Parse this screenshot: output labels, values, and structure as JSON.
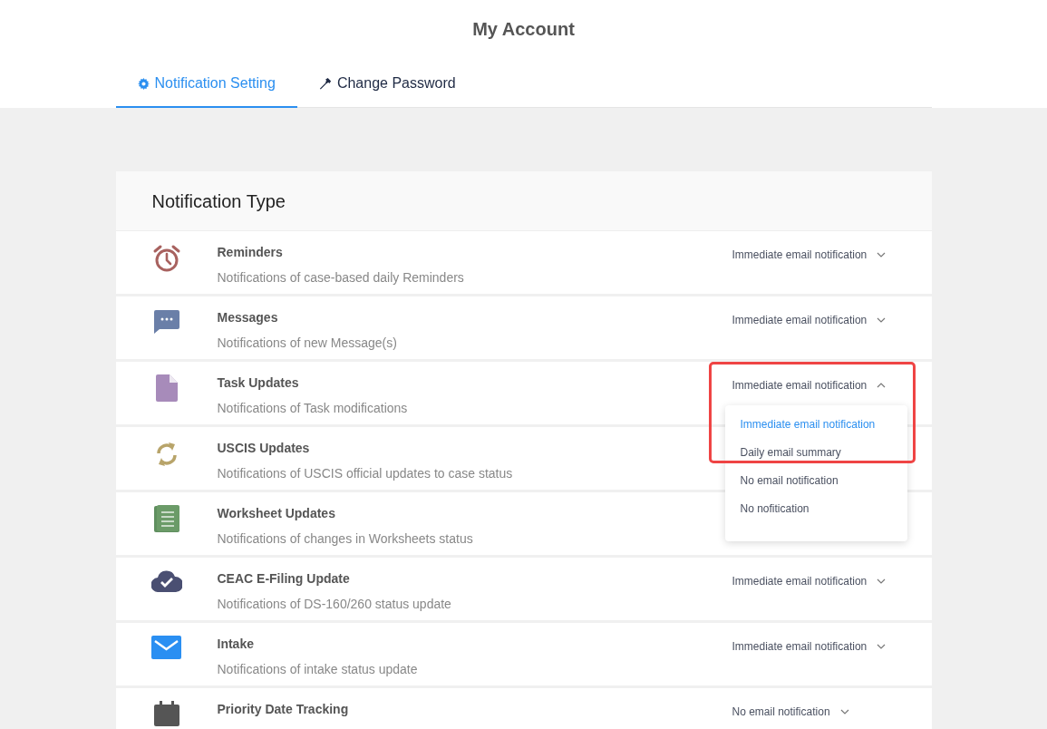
{
  "page": {
    "title": "My Account"
  },
  "tabs": [
    {
      "label": "Notification Setting",
      "selected": true
    },
    {
      "label": "Change Password",
      "selected": false
    }
  ],
  "card": {
    "title": "Notification Type"
  },
  "rows": [
    {
      "title": "Reminders",
      "description": "Notifications of case-based daily Reminders",
      "setting": {
        "value": "Immediate email notification",
        "expanded": false
      }
    },
    {
      "title": "Messages",
      "description": "Notifications of new Message(s)",
      "setting": {
        "value": "Immediate email notification",
        "expanded": false
      }
    },
    {
      "title": "Task Updates",
      "description": "Notifications of Task modifications",
      "setting": {
        "value": "Immediate email notification",
        "expanded": true,
        "highlighted": true,
        "options": [
          {
            "label": "Immediate email notification",
            "selected": true
          },
          {
            "label": "Daily email summary",
            "selected": false
          },
          {
            "label": "No email notification",
            "selected": false
          },
          {
            "label": "No nofitication",
            "selected": false
          }
        ]
      }
    },
    {
      "title": "USCIS Updates",
      "description": "Notifications of USCIS official updates to case status"
    },
    {
      "title": "Worksheet Updates",
      "description": "Notifications of changes in Worksheets status"
    },
    {
      "title": "CEAC E-Filing Update",
      "description": "Notifications of DS-160/260 status update",
      "setting": {
        "value": "Immediate email notification",
        "expanded": false
      }
    },
    {
      "title": "Intake",
      "description": "Notifications of intake status update",
      "setting": {
        "value": "Immediate email notification",
        "expanded": false
      }
    },
    {
      "title": "Priority Date Tracking",
      "setting": {
        "value": "No email notification",
        "expanded": false
      }
    }
  ]
}
